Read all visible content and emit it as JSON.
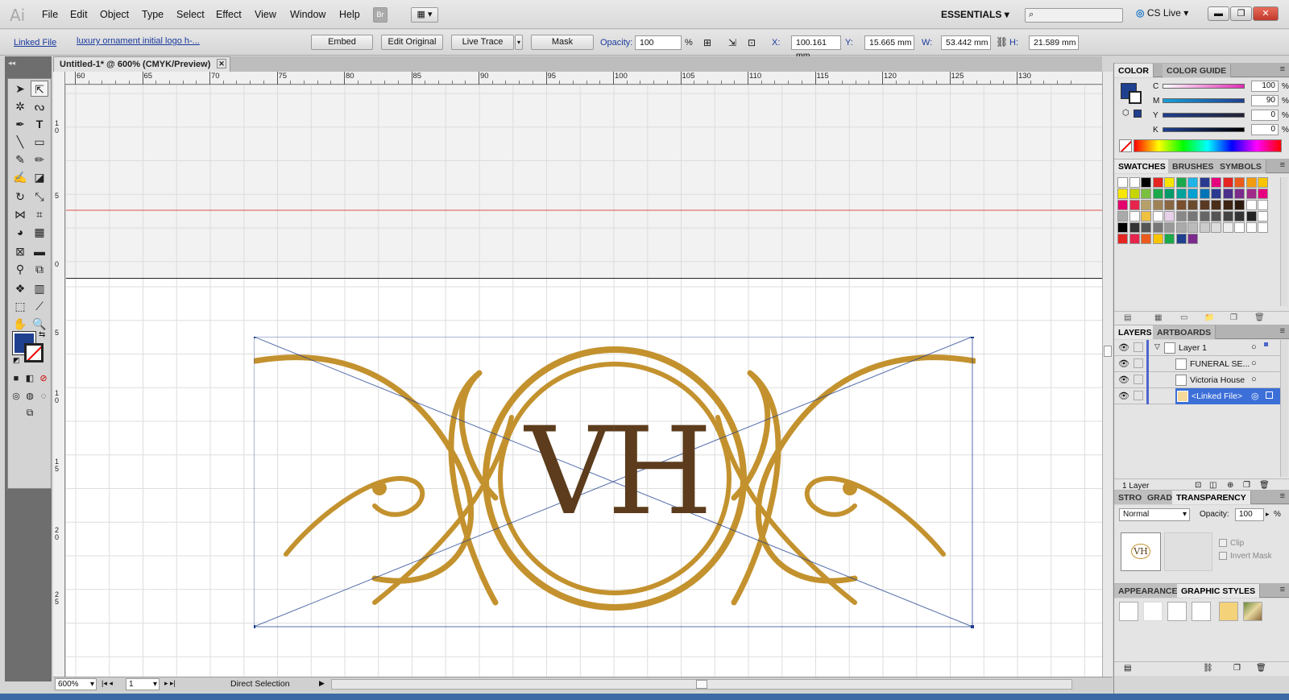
{
  "app": {
    "logo": "Ai"
  },
  "menu": [
    "File",
    "Edit",
    "Object",
    "Type",
    "Select",
    "Effect",
    "View",
    "Window",
    "Help"
  ],
  "menu_right": {
    "bridge": "Br",
    "workspace": "ESSENTIALS",
    "cslive": "CS Live"
  },
  "control": {
    "linked_file": "Linked File",
    "file_name": "luxury ornament initial logo h-...",
    "embed": "Embed",
    "edit_original": "Edit Original",
    "live_trace": "Live Trace",
    "mask": "Mask",
    "opacity_label": "Opacity:",
    "opacity_value": "100",
    "percent": "%",
    "x_label": "X:",
    "x_value": "100.161 mm",
    "y_label": "Y:",
    "y_value": "15.665 mm",
    "w_label": "W:",
    "w_value": "53.442 mm",
    "h_label": "H:",
    "h_value": "21.589 mm"
  },
  "document": {
    "tab_title": "Untitled-1* @ 600% (CMYK/Preview)"
  },
  "ruler": {
    "h_ticks": [
      "60",
      "65",
      "70",
      "75",
      "80",
      "85",
      "90",
      "95",
      "100",
      "105",
      "110",
      "115",
      "120",
      "125",
      "130"
    ],
    "v_ticks": [
      "1\n0",
      "5",
      "0",
      "5",
      "1\n0",
      "1\n5",
      "2\n0",
      "2\n5"
    ]
  },
  "logo": {
    "initials": "VH",
    "gold": "#c3922e",
    "brown": "#5c3c1c"
  },
  "statusbar": {
    "zoom": "600%",
    "page": "1",
    "tool": "Direct Selection"
  },
  "color_panel": {
    "tab1": "COLOR",
    "tab2": "COLOR GUIDE",
    "channels": [
      {
        "label": "C",
        "value": "100"
      },
      {
        "label": "M",
        "value": "90"
      },
      {
        "label": "Y",
        "value": "0"
      },
      {
        "label": "K",
        "value": "0"
      }
    ],
    "percent": "%",
    "fill_color": "#1f3f8f"
  },
  "swatches_panel": {
    "tabs": [
      "SWATCHES",
      "BRUSHES",
      "SYMBOLS"
    ]
  },
  "layers_panel": {
    "tabs": [
      "LAYERS",
      "ARTBOARDS"
    ],
    "rows": [
      "Layer 1",
      "FUNERAL SE...",
      "Victoria House",
      "<Linked File>"
    ],
    "footer": "1 Layer"
  },
  "transparency_panel": {
    "tabs": [
      "STRO",
      "GRAD",
      "TRANSPARENCY"
    ],
    "mode": "Normal",
    "opacity_label": "Opacity:",
    "opacity_value": "100",
    "percent": "%",
    "clip": "Clip",
    "invert_mask": "Invert Mask",
    "thumb_text": "VH"
  },
  "appearance_panel": {
    "tabs": [
      "APPEARANCE",
      "GRAPHIC STYLES"
    ]
  }
}
